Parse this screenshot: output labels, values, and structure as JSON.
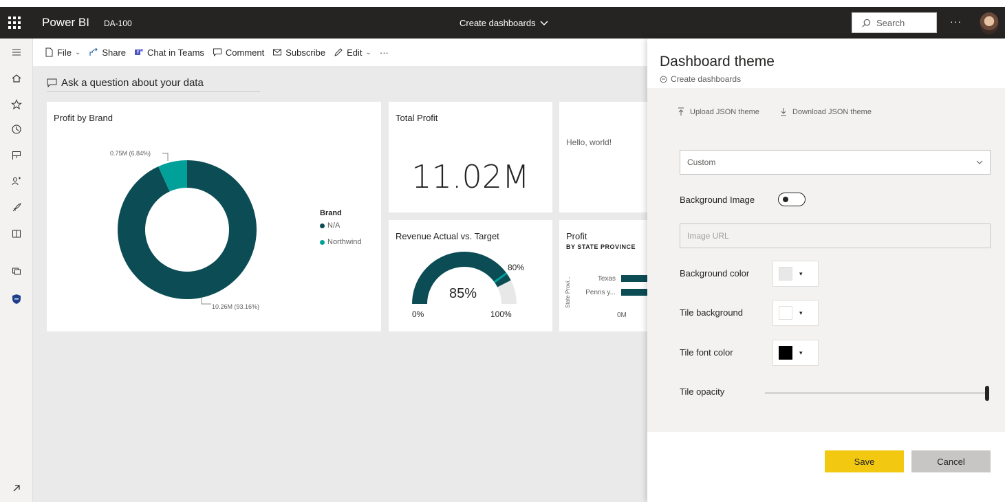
{
  "topbar": {
    "app_name": "Power BI",
    "workspace": "DA-100",
    "dashboard_title": "Create dashboards",
    "search_placeholder": "Search",
    "more": "···"
  },
  "commandbar": {
    "file": "File",
    "share": "Share",
    "chat": "Chat in Teams",
    "comment": "Comment",
    "subscribe": "Subscribe",
    "edit": "Edit",
    "more": "···"
  },
  "canvas": {
    "qa_prompt": "Ask a question about your data",
    "tiles": {
      "profit_by_brand": {
        "title": "Profit by Brand",
        "legend_title": "Brand",
        "legend_items": [
          "N/A",
          "Northwind"
        ],
        "label_small": "0.75M (6.84%)",
        "label_large": "10.26M (93.16%)"
      },
      "total_profit": {
        "title": "Total Profit",
        "value": "11.02M"
      },
      "hello": {
        "text": "Hello, world!"
      },
      "revenue_gauge": {
        "title": "Revenue Actual vs. Target",
        "value": "85%",
        "min": "0%",
        "max": "100%",
        "target": "80%"
      },
      "profit_bar": {
        "title": "Profit",
        "subtitle": "BY STATE PROVINCE",
        "axis_title": "State Provi...",
        "categories": [
          "Texas",
          "Penns y..."
        ],
        "zero_label": "0M"
      }
    }
  },
  "chart_data": [
    {
      "type": "pie",
      "title": "Profit by Brand",
      "categories": [
        "N/A",
        "Northwind"
      ],
      "values": [
        10.26,
        0.75
      ],
      "percent": [
        93.16,
        6.84
      ],
      "colors": [
        "#0b4c55",
        "#01a19a"
      ],
      "legend": "right"
    },
    {
      "type": "bar",
      "title": "Profit",
      "subtitle": "BY STATE PROVINCE",
      "categories": [
        "Texas",
        "Pennsy..."
      ],
      "values": [
        1,
        1
      ],
      "xlabel": "",
      "ylabel": "State Provi...",
      "color": "#0b4c55"
    }
  ],
  "gauge": {
    "value_fraction": 0.85,
    "target_fraction": 0.8,
    "fill_color": "#0b4c55",
    "target_color": "#01a19a"
  },
  "panel": {
    "title": "Dashboard theme",
    "subtitle": "Create dashboards",
    "upload": "Upload JSON theme",
    "download": "Download JSON theme",
    "theme_select": "Custom",
    "background_image_label": "Background Image",
    "background_image_on": false,
    "image_url_placeholder": "Image URL",
    "background_color_label": "Background color",
    "background_color": "#e8e8e8",
    "tile_background_label": "Tile background",
    "tile_background": "#ffffff",
    "tile_font_color_label": "Tile font color",
    "tile_font_color": "#000000",
    "tile_opacity_label": "Tile opacity",
    "tile_opacity": 1.0,
    "save": "Save",
    "cancel": "Cancel"
  },
  "colors": {
    "accent": "#f2c811",
    "topbar": "#252423",
    "teal_dark": "#0b4c55",
    "teal_light": "#01a19a"
  }
}
